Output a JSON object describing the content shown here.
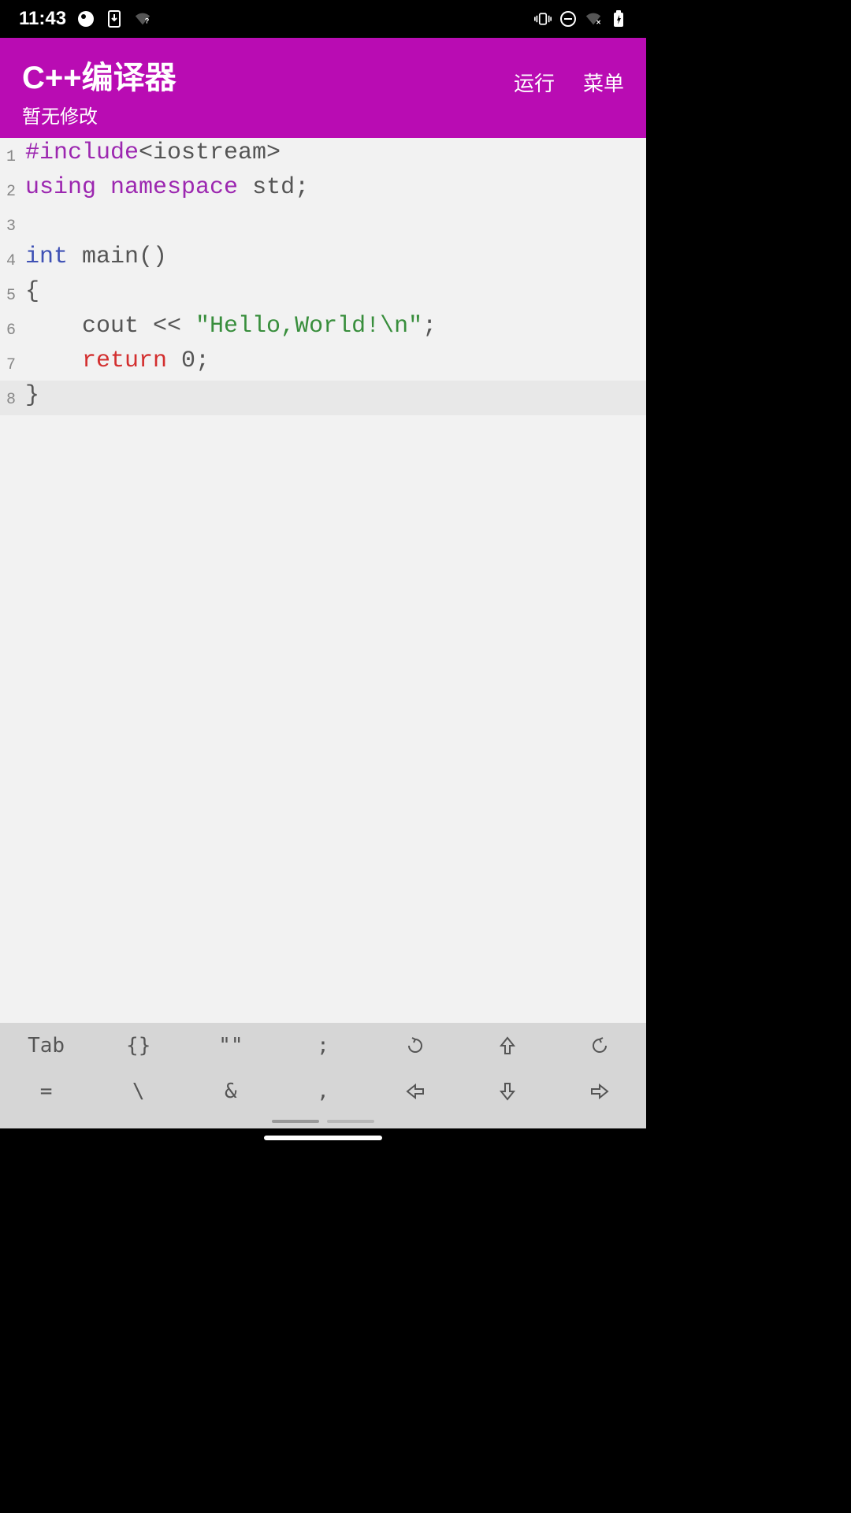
{
  "status": {
    "time": "11:43"
  },
  "header": {
    "title": "C++编译器",
    "subtitle": "暂无修改",
    "run_label": "运行",
    "menu_label": "菜单"
  },
  "code": {
    "lines": [
      {
        "num": "1"
      },
      {
        "num": "2"
      },
      {
        "num": "3"
      },
      {
        "num": "4"
      },
      {
        "num": "5"
      },
      {
        "num": "6"
      },
      {
        "num": "7"
      },
      {
        "num": "8"
      }
    ],
    "line1_preproc": "#include",
    "line1_angle": "<iostream>",
    "line2_kw1": "using",
    "line2_kw2": "namespace",
    "line2_ident": " std;",
    "line4_type": "int",
    "line4_rest": " main()",
    "line5": "{",
    "line6_indent": "    cout << ",
    "line6_str": "\"Hello,World!\\n\"",
    "line6_end": ";",
    "line7_indent": "    ",
    "line7_ret": "return",
    "line7_rest": " 0;",
    "line8": "}"
  },
  "toolbar": {
    "row1": {
      "k1": "Tab",
      "k2": "{}",
      "k3": "\"\"",
      "k4": ";"
    },
    "row2": {
      "k1": "=",
      "k2": "\\",
      "k3": "&",
      "k4": ","
    }
  }
}
